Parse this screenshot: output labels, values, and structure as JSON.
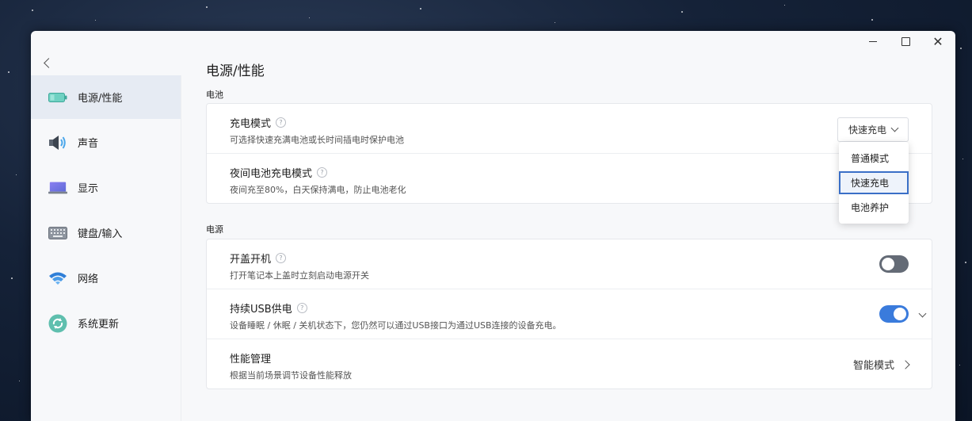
{
  "window": {
    "title": ""
  },
  "nav": {
    "back_icon": "chevron-left-icon",
    "items": [
      {
        "label": "电源/性能",
        "icon": "battery-icon",
        "active": true
      },
      {
        "label": "声音",
        "icon": "speaker-icon",
        "active": false
      },
      {
        "label": "显示",
        "icon": "laptop-display-icon",
        "active": false
      },
      {
        "label": "键盘/输入",
        "icon": "keyboard-icon",
        "active": false
      },
      {
        "label": "网络",
        "icon": "wifi-icon",
        "active": false
      },
      {
        "label": "系统更新",
        "icon": "update-icon",
        "active": false
      }
    ]
  },
  "page": {
    "title": "电源/性能",
    "battery_section": {
      "label": "电池",
      "charge_mode": {
        "title": "充电模式",
        "desc": "可选择快速充满电池或长时间插电时保护电池",
        "selected": "快速充电",
        "options": [
          "普通模式",
          "快速充电",
          "电池养护"
        ]
      },
      "night_charge": {
        "title": "夜间电池充电模式",
        "desc": "夜间充至80%，白天保持满电，防止电池老化"
      }
    },
    "power_section": {
      "label": "电源",
      "lid_power_on": {
        "title": "开盖开机",
        "desc": "打开笔记本上盖时立刻启动电源开关",
        "enabled": false
      },
      "usb_power": {
        "title": "持续USB供电",
        "desc": "设备睡眠 / 休眠 / 关机状态下，您仍然可以通过USB接口为通过USB连接的设备充电。",
        "enabled": true
      },
      "performance": {
        "title": "性能管理",
        "desc": "根据当前场景调节设备性能释放",
        "value": "智能模式"
      }
    }
  },
  "colors": {
    "accent": "#3a7bdc",
    "toggle_off": "#646b76",
    "active_nav_bg": "#e6ebf3"
  }
}
